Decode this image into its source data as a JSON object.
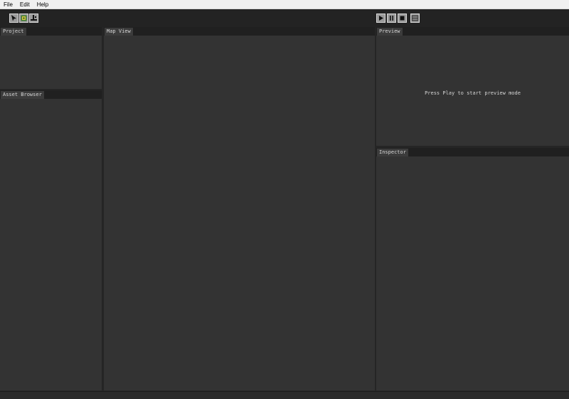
{
  "menu": {
    "items": [
      "File",
      "Edit",
      "Help"
    ]
  },
  "toolbar": {
    "left_tools": [
      "select-tool",
      "tile-tool",
      "entity-tool"
    ],
    "playback": [
      "play",
      "pause",
      "stop",
      "toggle-tool"
    ]
  },
  "panels": {
    "project": {
      "title": "Project"
    },
    "asset_browser": {
      "title": "Asset Browser"
    },
    "map_view": {
      "title": "Map View"
    },
    "preview": {
      "title": "Preview",
      "message": "Press Play to start preview mode"
    },
    "inspector": {
      "title": "Inspector"
    }
  },
  "colors": {
    "background": "#252525",
    "panel": "#333333",
    "tab_strip": "#202020",
    "tab": "#3c3c3c",
    "text": "#d8d8d8",
    "menubar": "#f0f0f0"
  }
}
